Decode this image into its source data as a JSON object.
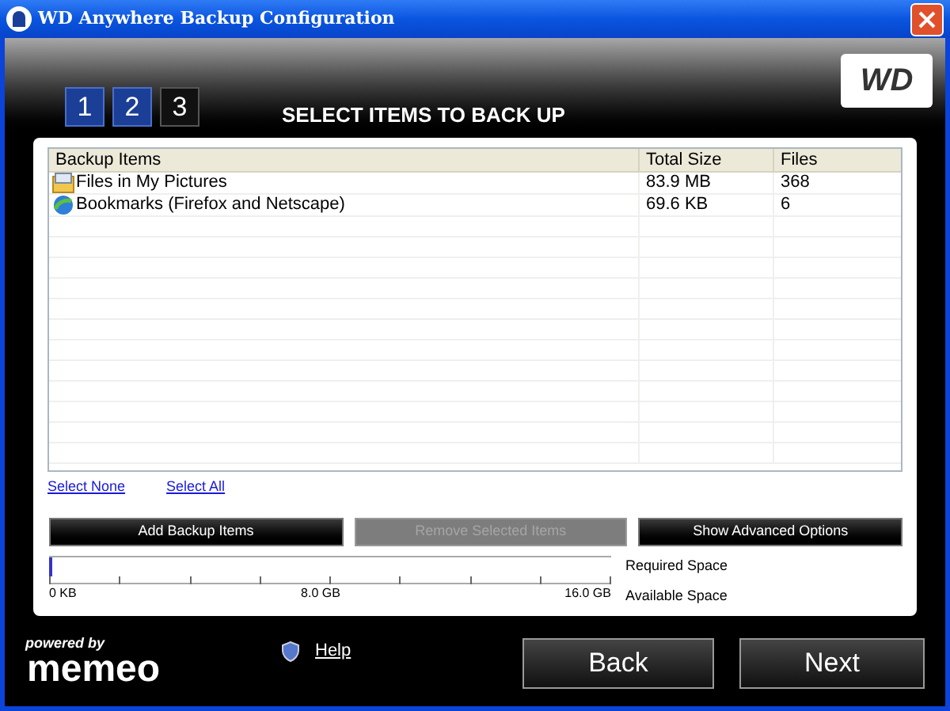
{
  "window": {
    "title": "WD Anywhere Backup Configuration"
  },
  "steps": [
    {
      "label": "1",
      "done": true
    },
    {
      "label": "2",
      "done": true
    },
    {
      "label": "3",
      "done": false
    }
  ],
  "heading": "SELECT ITEMS TO BACK UP",
  "logo": "WD",
  "table": {
    "columns": [
      "Backup Items",
      "Total Size",
      "Files"
    ],
    "rows": [
      {
        "kind": "folder",
        "name": "Files in My Pictures",
        "size": "83.9 MB",
        "files": "368"
      },
      {
        "kind": "globe",
        "name": "Bookmarks (Firefox and Netscape)",
        "size": "69.6 KB",
        "files": "6"
      }
    ]
  },
  "links": [
    "Select None",
    "Select All"
  ],
  "buttons": [
    {
      "label": "Add Backup Items",
      "disabled": false
    },
    {
      "label": "Remove Selected Items",
      "disabled": true
    },
    {
      "label": "Show Advanced Options",
      "disabled": false
    }
  ],
  "space_gauge": {
    "level": 0.005,
    "scale": [
      "0 KB",
      "8.0 GB",
      "16.0 GB"
    ],
    "legend": [
      "Required Space",
      "Available Space"
    ]
  },
  "footer": {
    "powered_by": "powered by",
    "brand": "memeo",
    "help": "Help",
    "back": "Back",
    "next": "Next"
  }
}
